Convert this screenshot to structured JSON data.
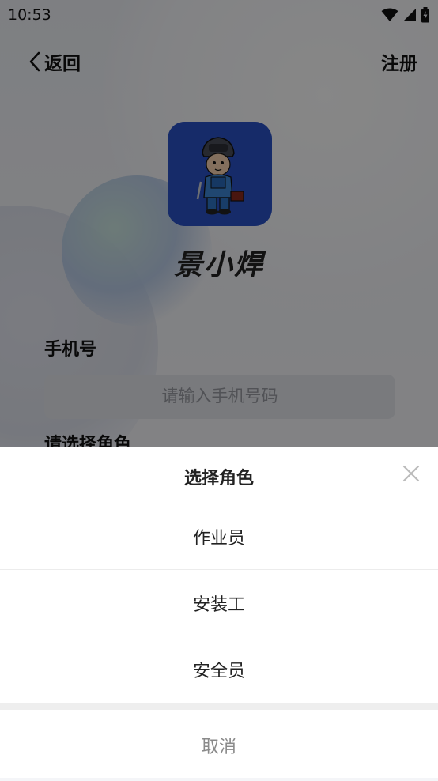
{
  "status_bar": {
    "time": "10:53"
  },
  "nav": {
    "back_label": "返回",
    "register_label": "注册"
  },
  "app": {
    "name": "景小焊"
  },
  "form": {
    "phone_label": "手机号",
    "phone_placeholder": "请输入手机号码",
    "role_label": "请选择角色"
  },
  "sheet": {
    "title": "选择角色",
    "options": [
      "作业员",
      "安装工",
      "安全员"
    ],
    "cancel_label": "取消"
  }
}
